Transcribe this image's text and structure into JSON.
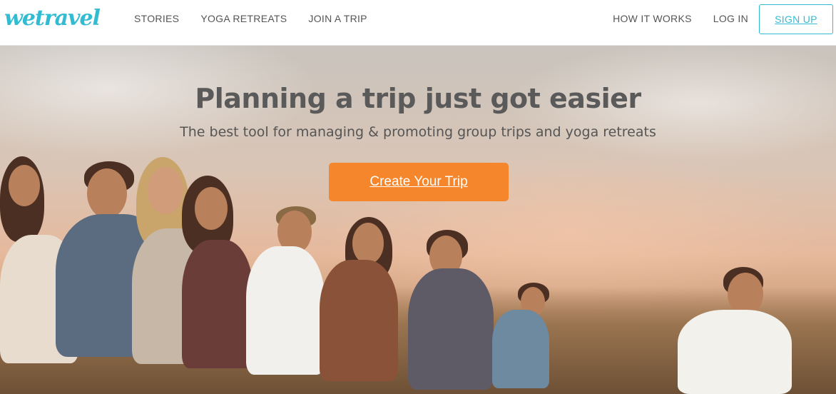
{
  "header": {
    "logo": "wetravel",
    "nav_left": [
      "STORIES",
      "YOGA RETREATS",
      "JOIN A TRIP"
    ],
    "nav_right": [
      "HOW IT WORKS",
      "LOG IN"
    ],
    "signup_label": "SIGN UP"
  },
  "hero": {
    "title": "Planning a trip just got easier",
    "subtitle": "The best tool for managing & promoting group trips and yoga retreats",
    "cta_label": "Create Your Trip",
    "image_description": "group-of-friends-sitting-on-hill-at-sunset"
  },
  "colors": {
    "brand": "#33bcd1",
    "cta": "#f5862b",
    "nav_text": "#555555"
  }
}
